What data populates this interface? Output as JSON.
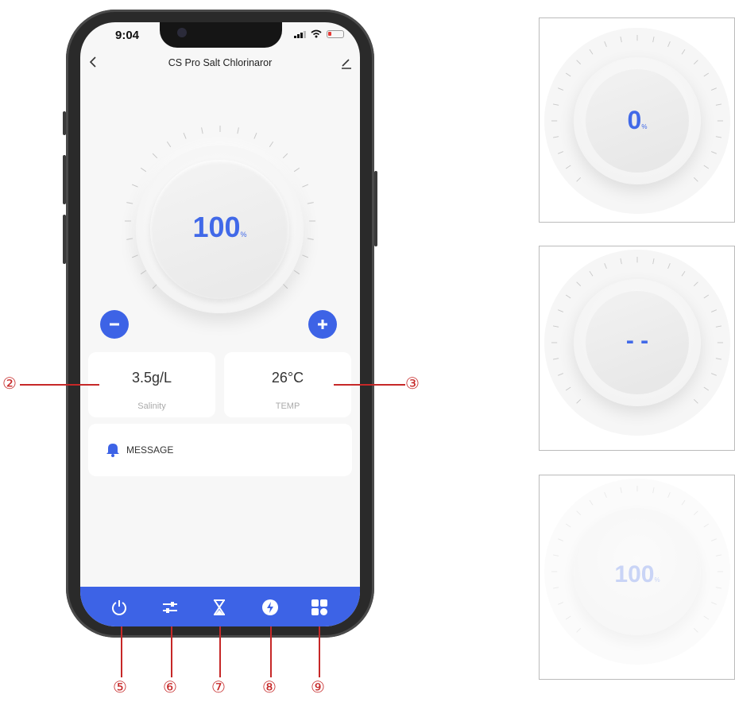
{
  "status": {
    "time": "9:04"
  },
  "header": {
    "title": "CS Pro Salt Chlorinaror",
    "back_icon": "chevron-left-icon",
    "edit_icon": "pencil-icon"
  },
  "dial": {
    "value": "100",
    "unit": "%",
    "level": 1.0
  },
  "controls": {
    "minus_icon": "minus-icon",
    "plus_icon": "plus-icon"
  },
  "cards": {
    "salinity": {
      "value": "3.5g/L",
      "label": "Salinity"
    },
    "temp": {
      "value": "26°C",
      "label": "TEMP"
    }
  },
  "message": {
    "label": "MESSAGE",
    "icon": "bell-icon"
  },
  "nav": {
    "icons": [
      "power-icon",
      "sliders-icon",
      "hourglass-icon",
      "lightning-icon",
      "grid-icon"
    ]
  },
  "callouts": {
    "c2": "②",
    "c3": "③",
    "c5": "⑤",
    "c6": "⑥",
    "c7": "⑦",
    "c8": "⑧",
    "c9": "⑨"
  },
  "states": [
    {
      "value": "0",
      "unit": "%"
    },
    {
      "value": "- -",
      "unit": ""
    },
    {
      "value": "100",
      "unit": "%",
      "faded": true
    }
  ],
  "colors": {
    "accent": "#3d63e6",
    "callout": "#c62828",
    "value_text": "#4169e8"
  }
}
